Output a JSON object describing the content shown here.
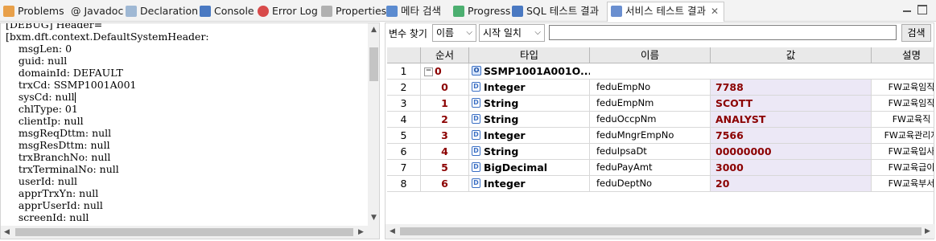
{
  "tabs": [
    {
      "label": "Problems",
      "icon": "problems-icon",
      "color": "#d2691e"
    },
    {
      "label": "@ Javadoc",
      "icon": "javadoc-icon",
      "color": "#555555"
    },
    {
      "label": "Declaration",
      "icon": "declaration-icon",
      "color": "#6a8caf"
    },
    {
      "label": "Console",
      "icon": "console-icon",
      "color": "#3a6fc4"
    },
    {
      "label": "Error Log",
      "icon": "error-log-icon",
      "color": "#cc3333"
    },
    {
      "label": "Properties",
      "icon": "properties-icon",
      "color": "#777777"
    },
    {
      "label": "메타 검색",
      "icon": "meta-search-icon",
      "color": "#3a6fc4"
    },
    {
      "label": "Progress",
      "icon": "progress-icon",
      "color": "#2e8b57"
    },
    {
      "label": "SQL 테스트 결과",
      "icon": "sql-test-icon",
      "color": "#3a6fc4"
    },
    {
      "label": "서비스 테스트 결과",
      "icon": "service-test-icon",
      "color": "#3a6fc4",
      "active": true
    }
  ],
  "tab_close": "✕",
  "console": {
    "lines": [
      "[DEBUG] Header=",
      "[bxm.dft.context.DefaultSystemHeader:",
      "    msgLen: 0",
      "    guid: null",
      "    domainId: DEFAULT",
      "    trxCd: SSMP1001A001",
      "    sysCd: null",
      "    chlType: 01",
      "    clientIp: null",
      "    msgReqDttm: null",
      "    msgResDttm: null",
      "    trxBranchNo: null",
      "    trxTerminalNo: null",
      "    userId: null",
      "    apprTrxYn: null",
      "    apprUserId: null",
      "    screenId: null"
    ]
  },
  "search": {
    "label": "변수 찾기",
    "field_select": "이름",
    "match_select": "시작 일치",
    "query": "",
    "button": "검색"
  },
  "grid": {
    "headers": {
      "seq": "순서",
      "type": "타입",
      "name": "이름",
      "value": "값",
      "desc": "설명"
    },
    "root": {
      "idx": "1",
      "seq": "0",
      "type": "SSMP1001A001O..."
    },
    "rows": [
      {
        "idx": "2",
        "seq": "0",
        "type": "Integer",
        "name": "feduEmpNo",
        "value": "7788",
        "desc": "FW교육임직"
      },
      {
        "idx": "3",
        "seq": "1",
        "type": "String",
        "name": "feduEmpNm",
        "value": "SCOTT",
        "desc": "FW교육임직"
      },
      {
        "idx": "4",
        "seq": "2",
        "type": "String",
        "name": "feduOccpNm",
        "value": "ANALYST",
        "desc": "FW교육직"
      },
      {
        "idx": "5",
        "seq": "3",
        "type": "Integer",
        "name": "feduMngrEmpNo",
        "value": "7566",
        "desc": "FW교육관리지"
      },
      {
        "idx": "6",
        "seq": "4",
        "type": "String",
        "name": "feduIpsaDt",
        "value": "00000000",
        "desc": "FW교육입사"
      },
      {
        "idx": "7",
        "seq": "5",
        "type": "BigDecimal",
        "name": "feduPayAmt",
        "value": "3000",
        "desc": "FW교육급이"
      },
      {
        "idx": "8",
        "seq": "6",
        "type": "Integer",
        "name": "feduDeptNo",
        "value": "20",
        "desc": "FW교육부서"
      }
    ]
  }
}
